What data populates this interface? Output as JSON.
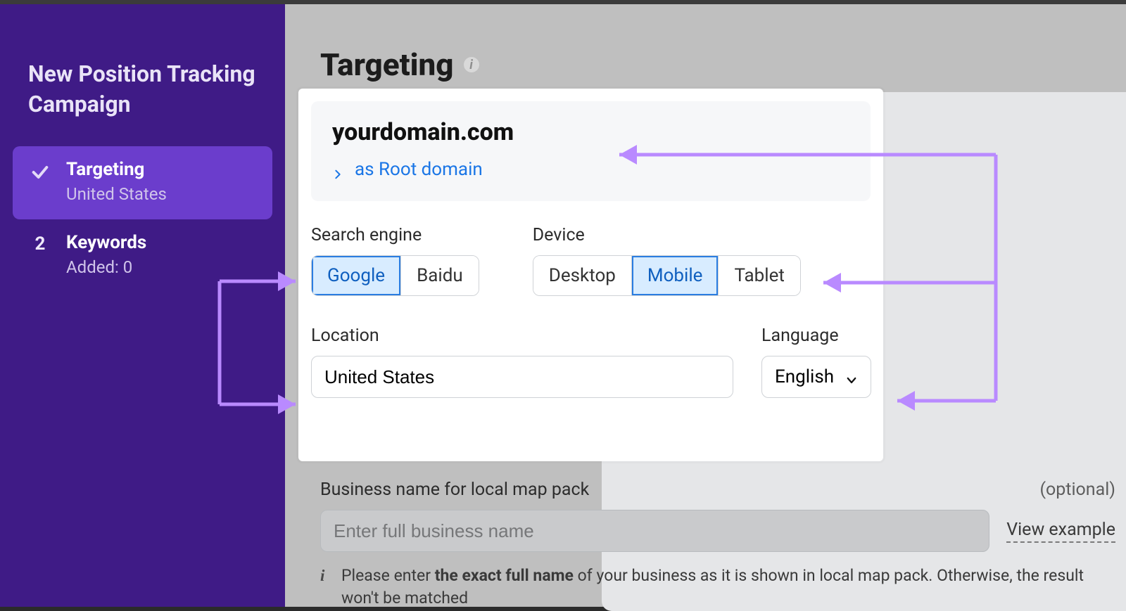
{
  "sidebar": {
    "title": "New Position Tracking Campaign",
    "steps": [
      {
        "label": "Targeting",
        "sub": "United States",
        "done": true
      },
      {
        "num": "2",
        "label": "Keywords",
        "sub": "Added: 0"
      }
    ]
  },
  "page": {
    "title": "Targeting"
  },
  "domain": {
    "name": "yourdomain.com",
    "link": "as Root domain"
  },
  "search_engine": {
    "label": "Search engine",
    "options": [
      "Google",
      "Baidu"
    ],
    "selected": "Google"
  },
  "device": {
    "label": "Device",
    "options": [
      "Desktop",
      "Mobile",
      "Tablet"
    ],
    "selected": "Mobile"
  },
  "location": {
    "label": "Location",
    "value": "United States"
  },
  "language": {
    "label": "Language",
    "value": "English"
  },
  "business": {
    "label": "Business name for local map pack",
    "optional": "(optional)",
    "placeholder": "Enter full business name",
    "view_example": "View example",
    "hint_prefix": "Please enter ",
    "hint_bold": "the exact full name",
    "hint_rest": " of your business as it is shown in local map pack. Otherwise, the result won't be matched"
  }
}
